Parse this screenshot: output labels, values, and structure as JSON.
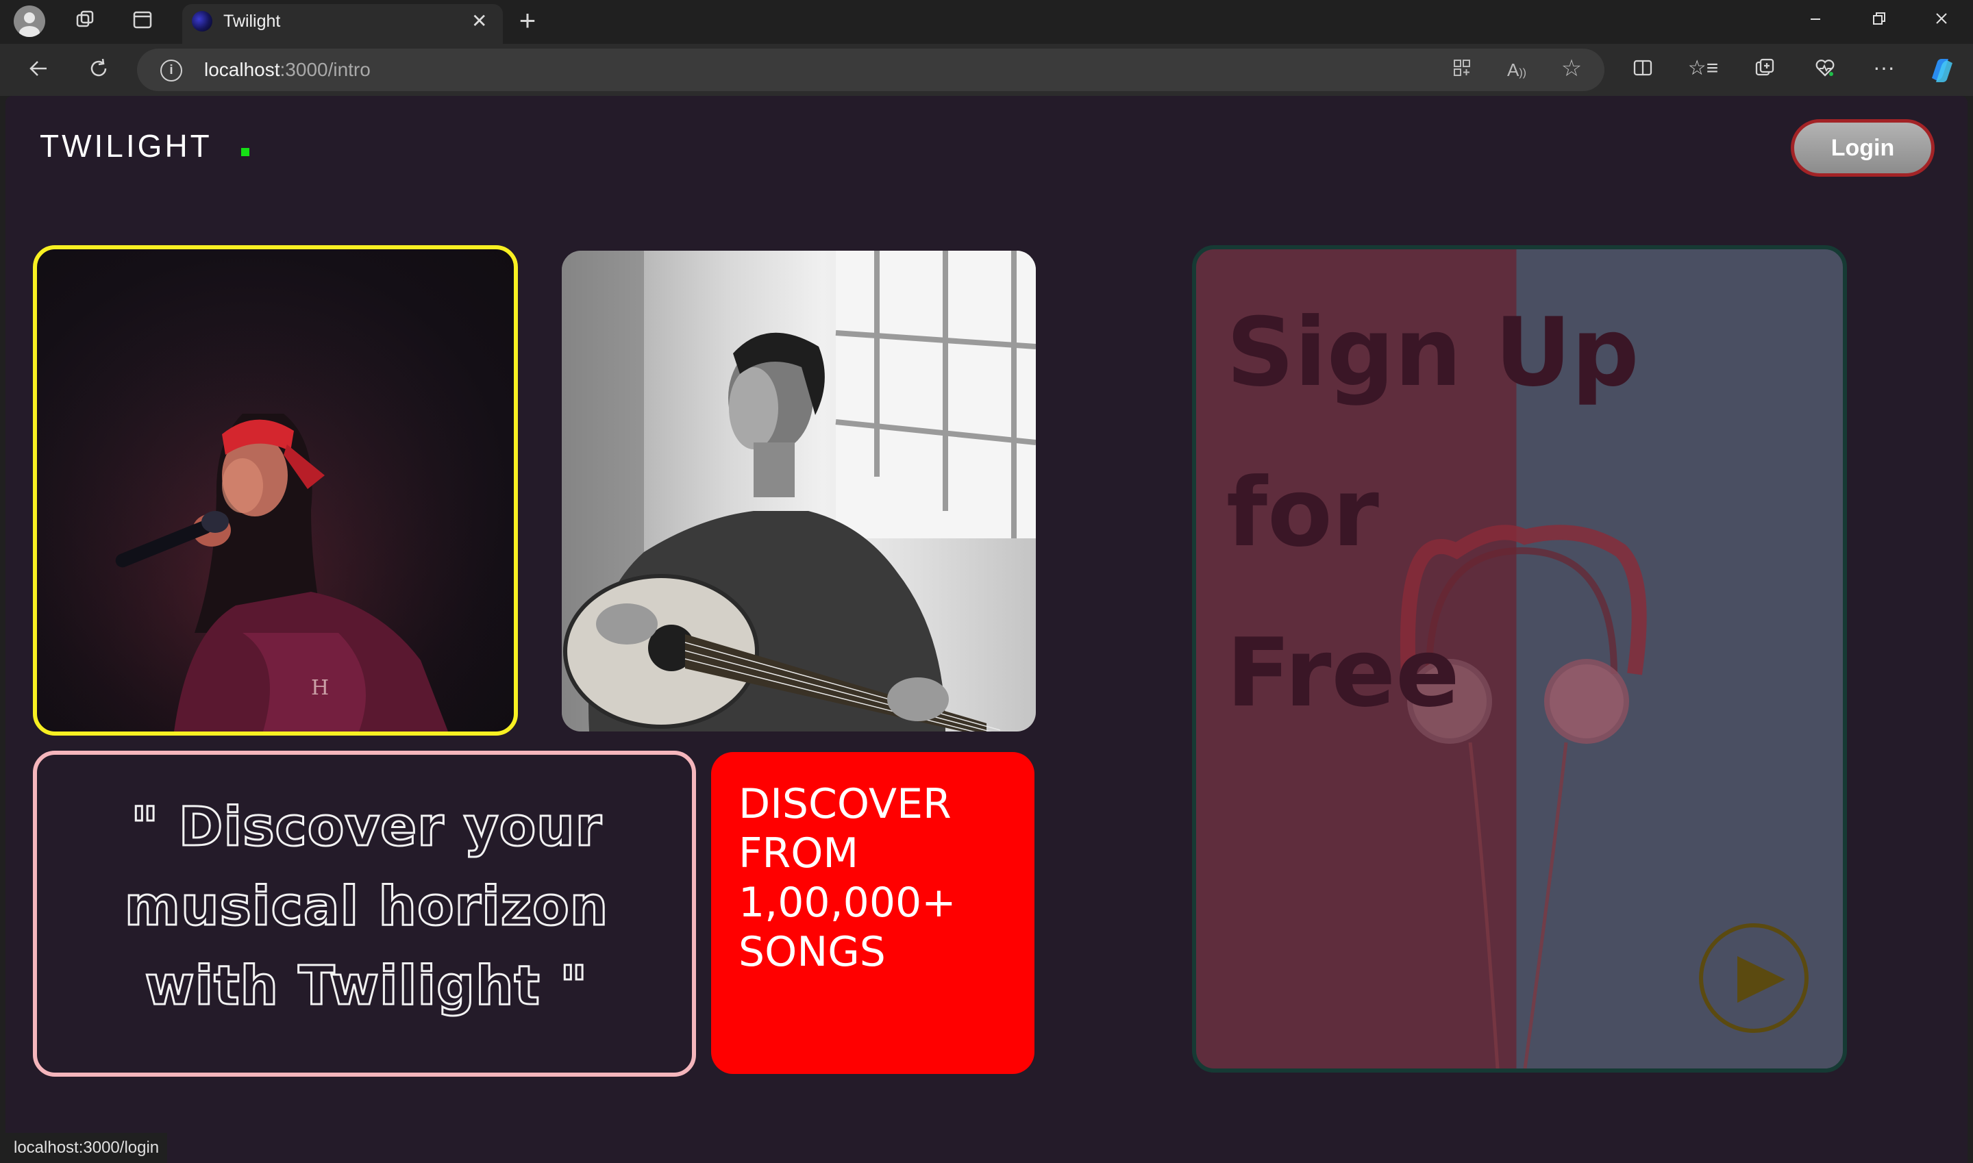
{
  "browser": {
    "tab_title": "Twilight",
    "tab_close": "✕",
    "new_tab": "+",
    "url_host": "localhost",
    "url_path": ":3000/intro",
    "status_url": "localhost:3000/login"
  },
  "header": {
    "logo": "TWILIGHT",
    "login_label": "Login"
  },
  "quote": {
    "line1": "\" Discover your",
    "line2": "musical horizon",
    "line3": "with Twilight \""
  },
  "discover": {
    "line1": "DISCOVER",
    "line2": "FROM",
    "line3": "1,00,000+",
    "line4": "SONGS"
  },
  "signup": {
    "line1": "Sign Up",
    "line2": "for",
    "line3": "Free"
  },
  "colors": {
    "page_bg": "#241b29",
    "logo_dot": "#15e015",
    "singer_border": "#f8f022",
    "quote_border": "#f5b6bc",
    "discover_bg": "#ff0000",
    "login_border": "#a32326"
  }
}
